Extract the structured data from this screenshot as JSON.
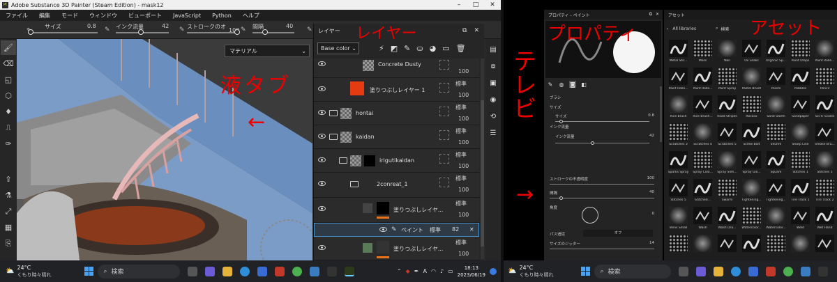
{
  "left_window": {
    "title": "Adobe Substance 3D Painter (Steam Edition) - mask12",
    "menu": [
      "ファイル",
      "編集",
      "モード",
      "ウィンドウ",
      "ビューポート",
      "JavaScript",
      "Python",
      "ヘルプ"
    ],
    "toolbar": {
      "size_label": "サイズ",
      "size_value": "0.8",
      "flow_label": "インク流量",
      "flow_value": "42",
      "stroke_label": "ストロークのオ",
      "stroke_value": "100",
      "spacing_label": "間隔",
      "spacing_value": "40"
    },
    "material_select": "マテリアル"
  },
  "layers": {
    "title": "レイヤー",
    "channel": "Base color",
    "rows": [
      {
        "name": "Concrete Dusty",
        "opacity": "100",
        "blend": ""
      },
      {
        "name": "塗りつぶしレイヤー 1",
        "opacity": "100",
        "blend": "標準"
      },
      {
        "name": "hontai",
        "opacity": "100",
        "blend": "標準"
      },
      {
        "name": "kaidan",
        "opacity": "100",
        "blend": "標準"
      },
      {
        "name": "irigutikaidan",
        "opacity": "100",
        "blend": "標準"
      },
      {
        "name": "2conreat_1",
        "opacity": "100",
        "blend": "標準"
      },
      {
        "name": "塗りつぶしレイヤ...",
        "opacity": "100",
        "blend": "標準"
      },
      {
        "name": "塗りつぶしレイヤ...",
        "opacity": "100",
        "blend": "標準"
      }
    ],
    "paint_effect": {
      "name": "ペイント",
      "blend": "標準",
      "opacity": "82"
    }
  },
  "annotations": {
    "layer_tab": "レイヤー",
    "liquid_tab": "液タブ",
    "arrow": "←",
    "tv": "テレビ",
    "property": "プロパティ",
    "asset": "アセット",
    "arrow2": "→"
  },
  "taskbar_left": {
    "temp": "24°C",
    "weather": "くもり時々晴れ",
    "search": "検索",
    "time": "18:13",
    "date": "2023/06/19"
  },
  "properties": {
    "title": "プロパティ - ペイント",
    "section": "ブラシ",
    "size_group": "サイズ",
    "size_label": "サイズ",
    "size_value": "0.8",
    "flow_group": "インク流量",
    "flow_label": "インク流量",
    "flow_value": "42",
    "stroke_label": "ストロークの不透明度",
    "stroke_value": "100",
    "spacing_label": "間隔",
    "spacing_value": "40",
    "angle_label": "角度",
    "angle_value": "0",
    "follow_label": "パス追従",
    "follow_value": "オフ",
    "jitter_label": "サイズのジッター",
    "jitter_value": "14"
  },
  "assets": {
    "title": "アセット",
    "library": "All libraries",
    "search": "検索",
    "items": [
      "Metal Sto...",
      "Moss",
      "Nail",
      "Oil Leaks",
      "Organic Sp...",
      "Paint Drops",
      "Paint Rolle...",
      "Paint Rolle...",
      "Paint Rolle...",
      "Paint Spray",
      "Pastel Brush",
      "Pearls",
      "Pebbles",
      "Pencil",
      "Rice Brush",
      "Rice Brush...",
      "Road Stripes",
      "Rococo",
      "Sand Storm",
      "Sandpaper",
      "Sci-Fi Scales",
      "Scratches 3",
      "Scratches 4",
      "Scratches 5",
      "Screw Bolt",
      "Shuhm",
      "Sharp Line",
      "Smoke Bru...",
      "Sparks Spray",
      "Spray Colo...",
      "Spray Slim...",
      "Spray Glo...",
      "Square",
      "Stitches 1",
      "Stitches 1",
      "Stitches 5",
      "Stitched...",
      "Swarm",
      "Tightening...",
      "Tightening...",
      "Tire Track 1",
      "Tire Track 2",
      "Veins Small",
      "Wash",
      "Wash Dra...",
      "Watercolor...",
      "Watercolor...",
      "Weld",
      "Wet Hand",
      "",
      "",
      "",
      "",
      "",
      "",
      ""
    ]
  },
  "taskbar_right": {
    "temp": "24°C",
    "weather": "くもり時々晴れ",
    "search": "検索"
  }
}
